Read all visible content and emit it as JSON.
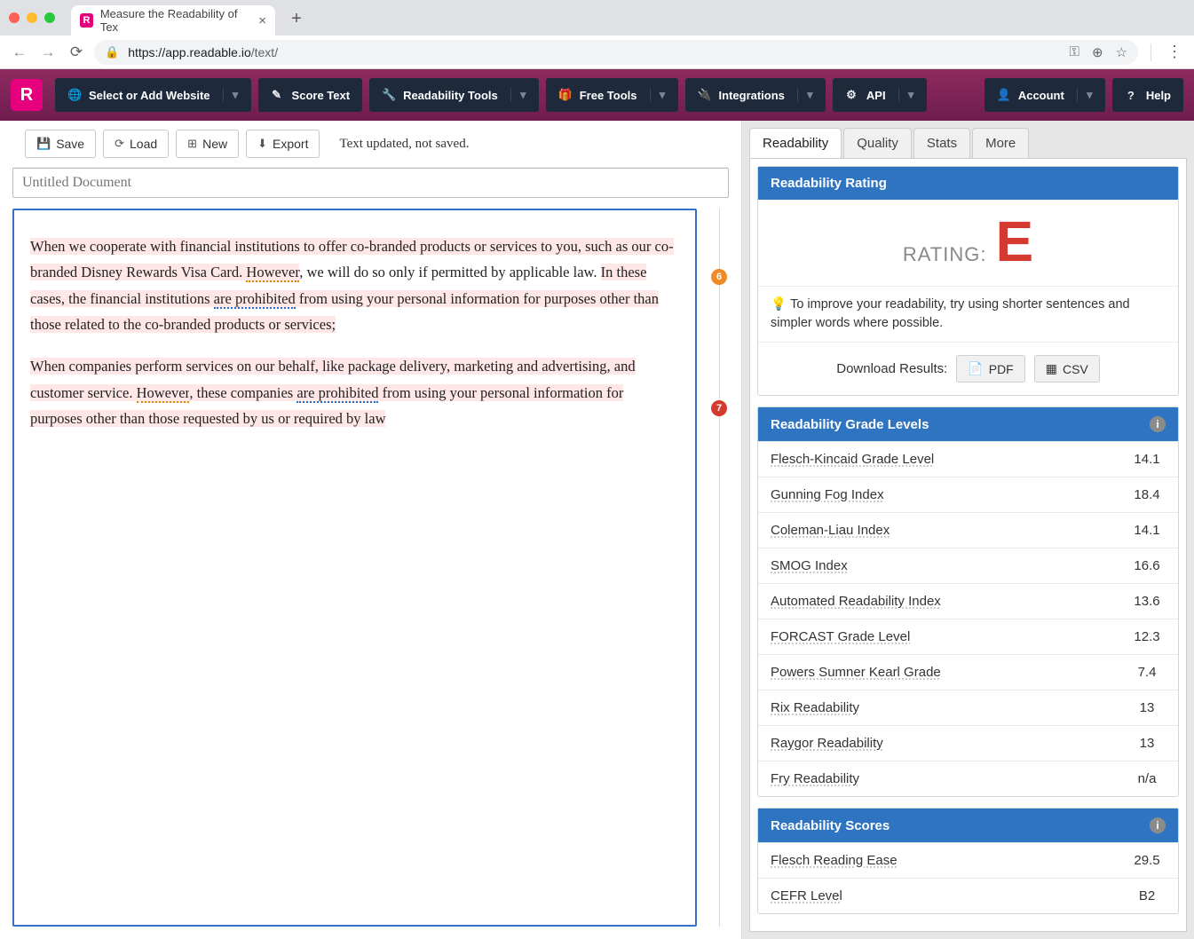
{
  "browser": {
    "tab_title": "Measure the Readability of Tex",
    "url_host": "https://app.readable.io",
    "url_path": "/text/"
  },
  "app_nav": {
    "website": "Select or Add Website",
    "score": "Score Text",
    "tools": "Readability Tools",
    "free": "Free Tools",
    "integrations": "Integrations",
    "api": "API",
    "account": "Account",
    "help": "Help"
  },
  "doc_toolbar": {
    "save": "Save",
    "load": "Load",
    "new": "New",
    "export": "Export",
    "status": "Text updated, not saved."
  },
  "title_placeholder": "Untitled Document",
  "paragraphs": {
    "p1a": "When we cooperate with financial institutions to offer co-branded products or services to you, such as our co-branded Disney Rewards Visa Card. ",
    "p1_however": "However",
    "p1b": ", we will do so only if permitted by applicable law. ",
    "p1c": "In these cases, the financial institutions ",
    "p1_proh": "are prohibited",
    "p1d": " from using your personal information for purposes other than those related to the co-branded products or services;",
    "p2a": "When companies perform services on our behalf, like package delivery, marketing and advertising, and customer service. ",
    "p2_however": "However",
    "p2b": ", these companies ",
    "p2_proh": "are prohibited",
    "p2c": " from using your personal information for purposes other than those requested by us or required by law"
  },
  "gutter": {
    "b1": "6",
    "b2": "7"
  },
  "tabs": {
    "readability": "Readability",
    "quality": "Quality",
    "stats": "Stats",
    "more": "More"
  },
  "rating": {
    "header": "Readability Rating",
    "label": "RATING:",
    "letter": "E",
    "tip": "To improve your readability, try using shorter sentences and simpler words where possible.",
    "download_label": "Download Results:",
    "pdf": "PDF",
    "csv": "CSV"
  },
  "grade_levels": {
    "header": "Readability Grade Levels",
    "rows": [
      {
        "name": "Flesch-Kincaid Grade Level",
        "value": "14.1"
      },
      {
        "name": "Gunning Fog Index",
        "value": "18.4"
      },
      {
        "name": "Coleman-Liau Index",
        "value": "14.1"
      },
      {
        "name": "SMOG Index",
        "value": "16.6"
      },
      {
        "name": "Automated Readability Index",
        "value": "13.6"
      },
      {
        "name": "FORCAST Grade Level",
        "value": "12.3"
      },
      {
        "name": "Powers Sumner Kearl Grade",
        "value": "7.4"
      },
      {
        "name": "Rix Readability",
        "value": "13"
      },
      {
        "name": "Raygor Readability",
        "value": "13"
      },
      {
        "name": "Fry Readability",
        "value": "n/a"
      }
    ]
  },
  "scores": {
    "header": "Readability Scores",
    "rows": [
      {
        "name": "Flesch Reading Ease",
        "value": "29.5"
      },
      {
        "name": "CEFR Level",
        "value": "B2"
      }
    ]
  }
}
